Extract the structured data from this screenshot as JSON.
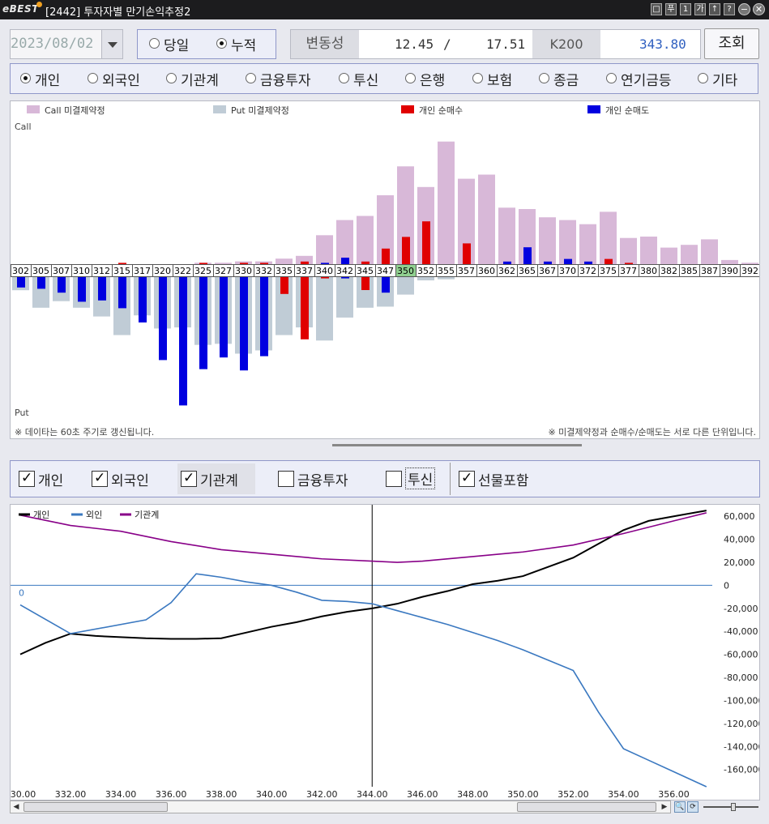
{
  "window": {
    "title": "[2442] 투자자별 만기손익추정2",
    "logo": "eBEST",
    "ctrl_buttons": [
      "□",
      "푸",
      "1",
      "가",
      "↑",
      "?"
    ]
  },
  "controls": {
    "date": "2023/08/02",
    "mode_options": [
      {
        "label": "당일",
        "selected": false
      },
      {
        "label": "누적",
        "selected": true
      }
    ],
    "volatility_label": "변동성",
    "vol_value1": "12.45",
    "vol_sep": "/",
    "vol_value2": "17.51",
    "index_label": "K200",
    "index_value": "343.80",
    "query_button": "조회"
  },
  "investors": [
    {
      "label": "개인",
      "selected": true
    },
    {
      "label": "외국인",
      "selected": false
    },
    {
      "label": "기관계",
      "selected": false
    },
    {
      "label": "금융투자",
      "selected": false
    },
    {
      "label": "투신",
      "selected": false
    },
    {
      "label": "은행",
      "selected": false
    },
    {
      "label": "보험",
      "selected": false
    },
    {
      "label": "종금",
      "selected": false
    },
    {
      "label": "연기금등",
      "selected": false
    },
    {
      "label": "기타",
      "selected": false
    }
  ],
  "oi_chart": {
    "legend": [
      {
        "label": "Call 미결제약정",
        "color": "#d8b8d8"
      },
      {
        "label": "Put 미결제약정",
        "color": "#c0ccd6"
      },
      {
        "label": "개인 순매수",
        "color": "#e00000"
      },
      {
        "label": "개인 순매도",
        "color": "#0000e0"
      }
    ],
    "call_label": "Call",
    "put_label": "Put",
    "note_left": "※ 데이타는 60초 주기로 갱신됩니다.",
    "note_right": "※ 미결제약정과 순매수/순매도는 서로 다른 단위입니다.",
    "highlight_strike": "350",
    "strikes": [
      "302",
      "305",
      "307",
      "310",
      "312",
      "315",
      "317",
      "320",
      "322",
      "325",
      "327",
      "330",
      "332",
      "335",
      "337",
      "340",
      "342",
      "345",
      "347",
      "350",
      "352",
      "355",
      "357",
      "360",
      "362",
      "365",
      "367",
      "370",
      "372",
      "375",
      "377",
      "380",
      "382",
      "385",
      "387",
      "390",
      "392"
    ],
    "call_oi": [
      0,
      0,
      0,
      0,
      0,
      0,
      0,
      0,
      0,
      1,
      1,
      2,
      2,
      4,
      6,
      21,
      32,
      35,
      50,
      71,
      56,
      89,
      62,
      65,
      41,
      40,
      34,
      32,
      29,
      38,
      19,
      20,
      12,
      14,
      18,
      3,
      1
    ],
    "call_net": [
      0,
      0,
      0,
      0,
      0,
      1,
      0,
      0,
      0,
      1,
      0,
      1,
      1,
      0,
      2,
      1,
      5,
      2,
      12,
      21,
      33,
      0,
      16,
      0,
      2,
      13,
      2,
      4,
      2,
      4,
      1,
      0,
      0,
      0,
      0,
      0,
      0
    ],
    "call_net_sign": [
      0,
      0,
      0,
      0,
      0,
      1,
      0,
      0,
      0,
      1,
      0,
      1,
      1,
      0,
      1,
      -1,
      -1,
      1,
      1,
      1,
      1,
      -1,
      1,
      -1,
      -1,
      -1,
      -1,
      -1,
      -1,
      1,
      1,
      0,
      0,
      0,
      0,
      0,
      0
    ],
    "put_oi": [
      12,
      28,
      22,
      28,
      36,
      53,
      35,
      47,
      46,
      62,
      61,
      70,
      67,
      53,
      46,
      58,
      37,
      28,
      27,
      16,
      3,
      2,
      0,
      0,
      0,
      0,
      0,
      0,
      0,
      0,
      0,
      0,
      0,
      0,
      0,
      0,
      0
    ],
    "put_net": [
      8,
      9,
      12,
      19,
      18,
      24,
      35,
      64,
      99,
      71,
      62,
      72,
      61,
      13,
      48,
      1,
      1,
      10,
      12,
      0,
      0,
      0,
      0,
      0,
      0,
      0,
      0,
      0,
      0,
      0,
      0,
      0,
      0,
      0,
      0,
      0,
      0
    ],
    "put_net_sign": [
      -1,
      -1,
      -1,
      -1,
      -1,
      -1,
      -1,
      -1,
      -1,
      -1,
      -1,
      -1,
      -1,
      1,
      1,
      1,
      -1,
      1,
      -1,
      0,
      0,
      0,
      0,
      0,
      0,
      0,
      0,
      0,
      0,
      0,
      0,
      0,
      0,
      0,
      0,
      0,
      0
    ]
  },
  "checks": [
    {
      "label": "개인",
      "checked": true
    },
    {
      "label": "외국인",
      "checked": true
    },
    {
      "label": "기관계",
      "checked": true
    },
    {
      "label": "금융투자",
      "checked": false
    },
    {
      "label": "투신",
      "checked": false
    },
    {
      "label": "선물포함",
      "checked": true
    }
  ],
  "colors": {
    "individual": "#000000",
    "foreign": "#3a78c0",
    "institution": "#880088",
    "accent_value": "#3060c0"
  },
  "chart_data": {
    "type": "line",
    "legend_placement": "top-left",
    "xlim": [
      330,
      357.5
    ],
    "ylim": [
      -175000,
      70000
    ],
    "x_ticks": [
      "330.00",
      "332.00",
      "334.00",
      "336.00",
      "338.00",
      "340.00",
      "342.00",
      "344.00",
      "346.00",
      "348.00",
      "350.00",
      "352.00",
      "354.00",
      "356.00"
    ],
    "y_ticks": [
      "60,000",
      "40,000",
      "20,000",
      "0",
      "-20,000",
      "-40,000",
      "-60,000",
      "-80,000",
      "-100,000",
      "-120,000",
      "-140,000",
      "-160,000"
    ],
    "zero_label": "0",
    "crosshair_x": 344,
    "series": [
      {
        "name": "개인",
        "color": "#000000",
        "x": [
          330,
          331,
          332,
          333,
          334,
          335,
          336,
          337,
          338,
          339,
          340,
          341,
          342,
          343,
          344,
          345,
          346,
          347,
          348,
          349,
          350,
          351,
          352,
          353,
          354,
          355,
          356,
          357.3
        ],
        "y": [
          -60000,
          -50000,
          -42000,
          -44000,
          -45000,
          -46000,
          -46500,
          -46500,
          -46000,
          -41000,
          -36000,
          -32000,
          -27000,
          -23000,
          -20000,
          -16000,
          -10000,
          -5000,
          1000,
          4000,
          8000,
          16000,
          24000,
          36000,
          48000,
          56000,
          60000,
          65000
        ]
      },
      {
        "name": "외인",
        "color": "#3a78c0",
        "x": [
          330,
          332,
          335,
          336,
          337,
          338,
          339,
          340,
          341,
          342,
          343,
          344,
          345,
          346,
          347,
          348,
          349,
          350,
          351,
          352,
          353,
          354,
          355,
          356,
          357.3
        ],
        "y": [
          -17000,
          -42000,
          -30000,
          -15000,
          10000,
          7000,
          3000,
          0,
          -6000,
          -13000,
          -14000,
          -16000,
          -22000,
          -28000,
          -34000,
          -41000,
          -48000,
          -56000,
          -65000,
          -74000,
          -110000,
          -142000,
          -152000,
          -162000,
          -175000
        ]
      },
      {
        "name": "기관계",
        "color": "#880088",
        "x": [
          330,
          332,
          334,
          336,
          338,
          340,
          342,
          344,
          345,
          346,
          348,
          350,
          352,
          354,
          356,
          357.3
        ],
        "y": [
          61000,
          52000,
          47000,
          38000,
          31000,
          27000,
          23000,
          21000,
          20000,
          21000,
          25000,
          29000,
          35000,
          45000,
          56000,
          63000
        ]
      }
    ]
  }
}
